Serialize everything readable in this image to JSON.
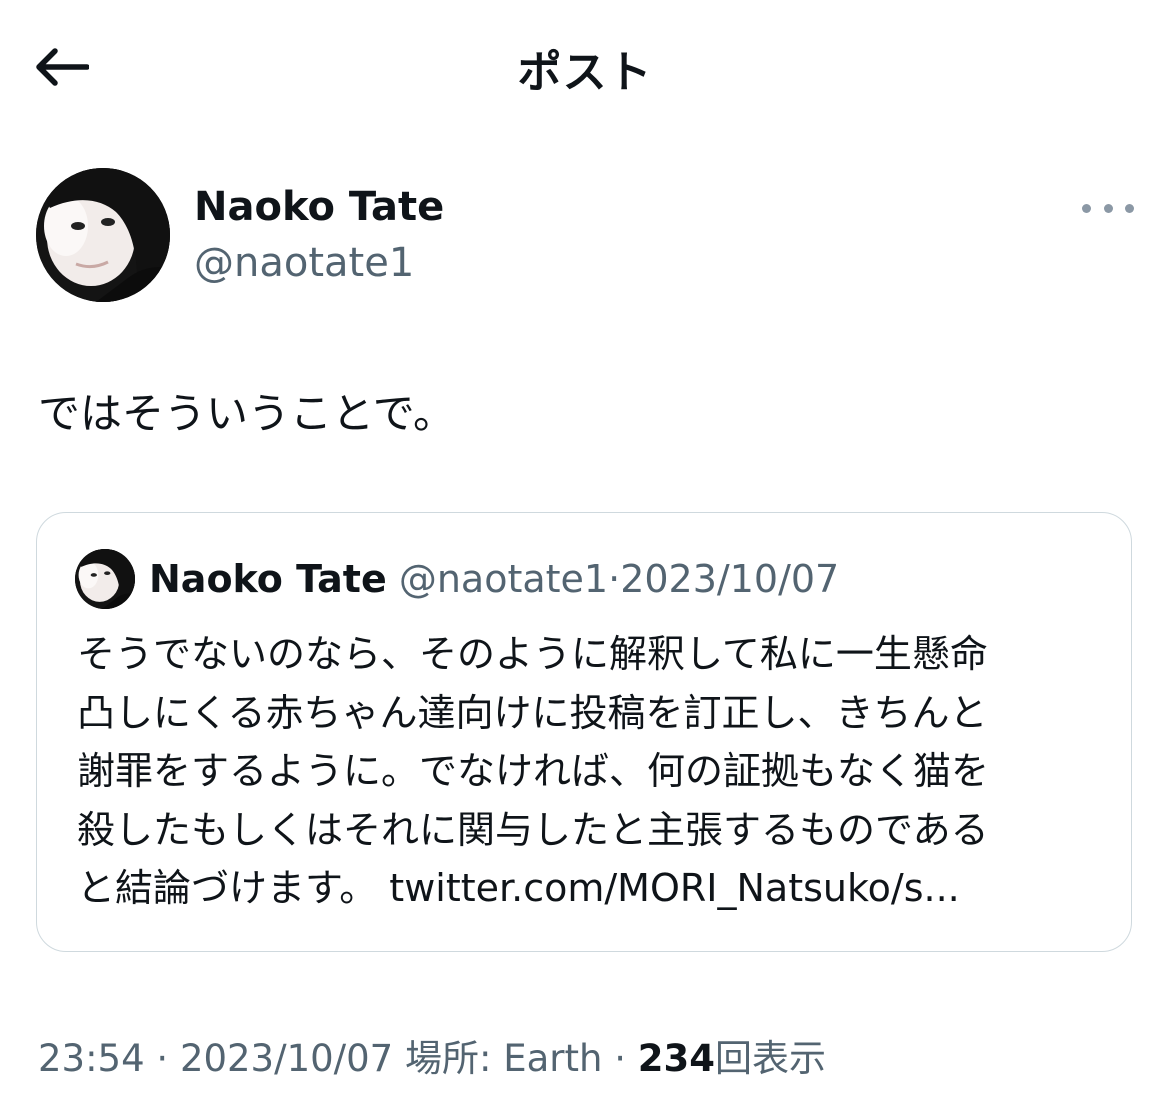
{
  "header": {
    "title": "ポスト",
    "back_icon": "arrow-left-icon"
  },
  "author": {
    "name": "Naoko Tate",
    "handle": "@naotate1",
    "more_icon": "more-horizontal-icon"
  },
  "post": {
    "text": "ではそういうことで。"
  },
  "quoted_post": {
    "name": "Naoko Tate",
    "handle": "@naotate1",
    "separator": "·",
    "date": "2023/10/07",
    "lines": [
      "そうでないのなら、そのように解釈して私に一生懸命",
      "凸しにくる赤ちゃん達向けに投稿を訂正し、きちんと",
      "謝罪をするように。でなければ、何の証拠もなく猫を",
      "殺したもしくはそれに関与したと主張するものである"
    ],
    "last_line_text": "と結論づけます。",
    "link": "twitter.com/MORI_Natsuko/s..."
  },
  "meta": {
    "time": "23:54",
    "sep1": "·",
    "date": "2023/10/07",
    "location": "場所: Earth",
    "sep2": "·",
    "views": "234",
    "views_label": "回表示"
  },
  "colors": {
    "text": "#0f1419",
    "secondary": "#536471",
    "border": "#cfd9de"
  }
}
